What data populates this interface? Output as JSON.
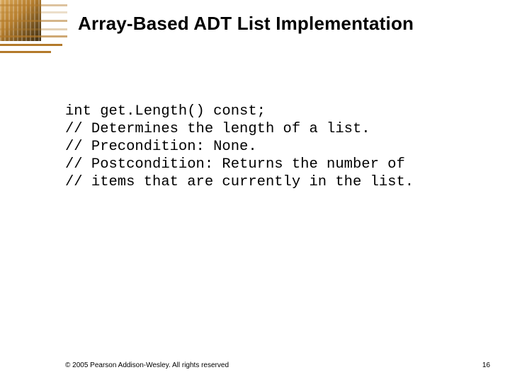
{
  "title": "Array-Based ADT List Implementation",
  "code": {
    "l1": "int get.Length() const;",
    "l2": "// Determines the length of a list.",
    "l3": "// Precondition: None.",
    "l4": "// Postcondition: Returns the number of",
    "l5": "// items that are currently in the list."
  },
  "footer": {
    "copyright": "© 2005 Pearson Addison-Wesley. All rights reserved",
    "page": "16"
  }
}
